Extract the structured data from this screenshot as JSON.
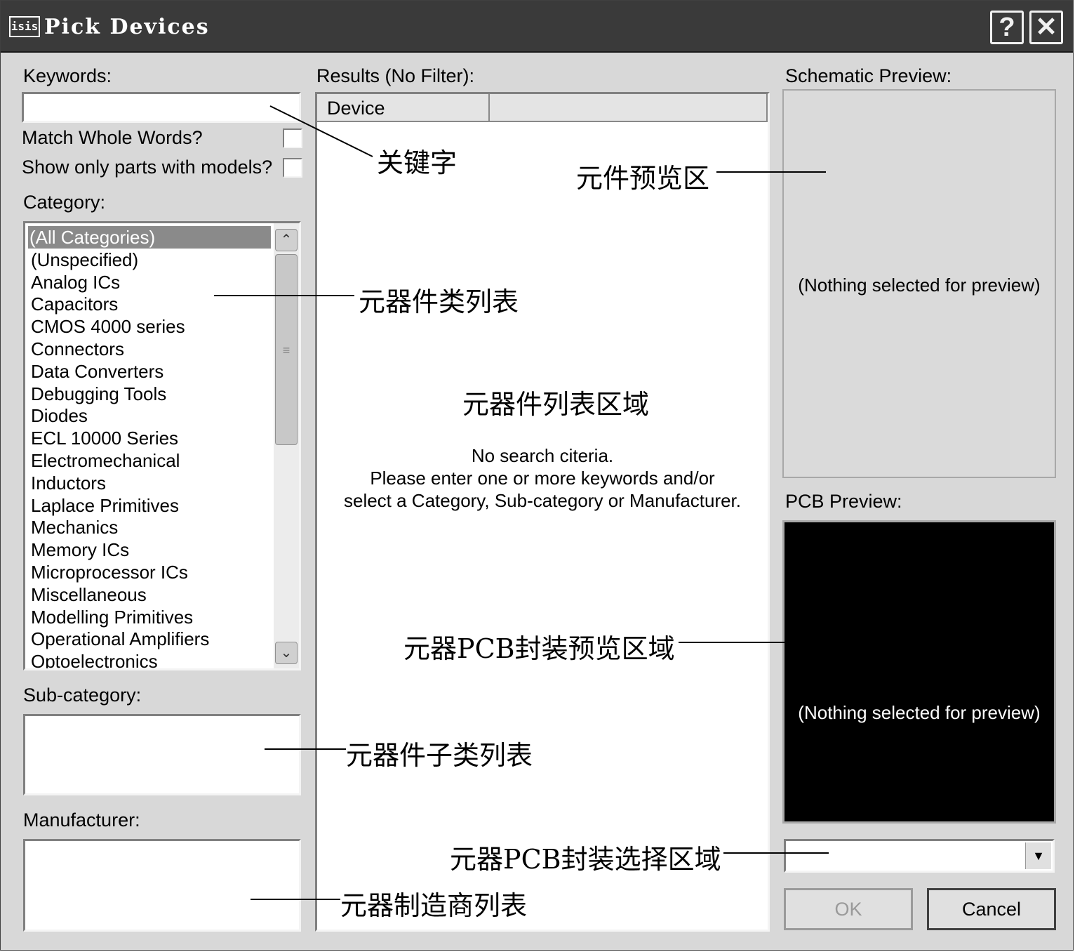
{
  "window": {
    "app_icon": "isis",
    "title": "Pick Devices",
    "help_button": "?",
    "close_button": "✕"
  },
  "left": {
    "keywords_label": "Keywords:",
    "keywords_value": "",
    "match_whole_words": "Match Whole Words?",
    "show_only_models": "Show only parts with models?",
    "category_label": "Category:",
    "categories": [
      "(All Categories)",
      "(Unspecified)",
      "Analog ICs",
      "Capacitors",
      "CMOS 4000 series",
      "Connectors",
      "Data Converters",
      "Debugging Tools",
      "Diodes",
      "ECL 10000 Series",
      "Electromechanical",
      "Inductors",
      "Laplace Primitives",
      "Mechanics",
      "Memory ICs",
      "Microprocessor ICs",
      "Miscellaneous",
      "Modelling Primitives",
      "Operational Amplifiers",
      "Optoelectronics"
    ],
    "subcategory_label": "Sub-category:",
    "manufacturer_label": "Manufacturer:"
  },
  "middle": {
    "results_label": "Results (No Filter):",
    "column_device": "Device",
    "message_line1": "No search citeria.",
    "message_line2": "Please enter one or more keywords and/or",
    "message_line3": "select a Category, Sub-category or Manufacturer."
  },
  "right": {
    "schematic_label": "Schematic Preview:",
    "schematic_empty": "(Nothing selected for preview)",
    "pcb_label": "PCB Preview:",
    "pcb_empty": "(Nothing selected for preview)",
    "package_select_value": "",
    "ok_label": "OK",
    "cancel_label": "Cancel"
  },
  "annotations": {
    "keywords": "关键字",
    "component_preview": "元件预览区",
    "category_list": "元器件类列表",
    "device_list_area": "元器件列表区域",
    "pcb_preview_area": "元器PCB封装预览区域",
    "subcategory_list": "元器件子类列表",
    "pcb_select_area": "元器PCB封装选择区域",
    "manufacturer_list": "元器制造商列表"
  },
  "colors": {
    "titlebar": "#3a3a3a",
    "dialog_bg": "#d8d8d8",
    "selected_item": "#8a8a8a",
    "pcb_preview_bg": "#000000"
  }
}
